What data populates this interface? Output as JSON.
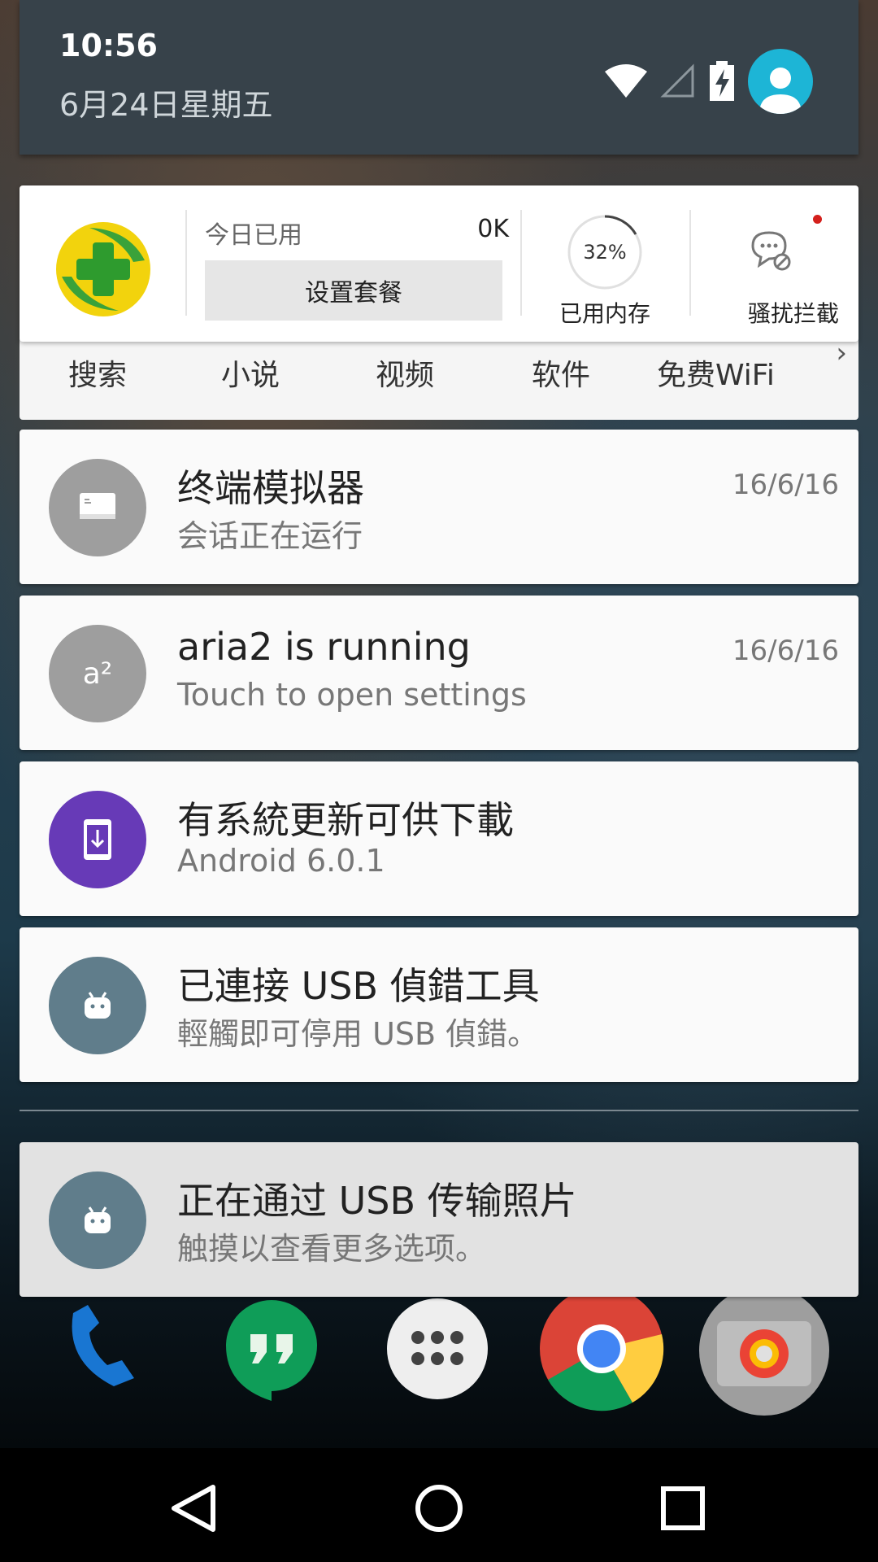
{
  "status": {
    "time": "10:56",
    "date": "6月24日星期五"
  },
  "card360": {
    "usage_label": "今日已用",
    "usage_value": "0K",
    "plan_button": "设置套餐",
    "memory_percent": "32%",
    "memory_label": "已用内存",
    "block_label": "骚扰拦截"
  },
  "shortcuts": {
    "items": [
      "搜索",
      "小说",
      "视频",
      "软件",
      "免费WiFi"
    ]
  },
  "notifications": [
    {
      "title": "终端模拟器",
      "text": "会话正在运行",
      "time": "16/6/16",
      "icon": "terminal-icon",
      "color": "#9e9e9e"
    },
    {
      "title": "aria2 is running",
      "text": "Touch to open settings",
      "time": "16/6/16",
      "icon": "aria2-icon",
      "icon_text": "a²",
      "color": "#9e9e9e"
    },
    {
      "title": "有系統更新可供下載",
      "text": "Android 6.0.1",
      "time": "",
      "icon": "system-update-icon",
      "color": "#673ab7"
    },
    {
      "title": "已連接 USB 偵錯工具",
      "text": "輕觸即可停用 USB 偵錯。",
      "time": "",
      "icon": "android-debug-icon",
      "color": "#607d8b"
    },
    {
      "title": "正在通过 USB 传输照片",
      "text": "触摸以查看更多选项。",
      "time": "",
      "icon": "android-usb-icon",
      "color": "#607d8b"
    }
  ],
  "colors": {
    "header_bg": "#37424a",
    "avatar": "#1db5d6",
    "update_purple": "#673ab7",
    "usb_slate": "#607d8b"
  }
}
